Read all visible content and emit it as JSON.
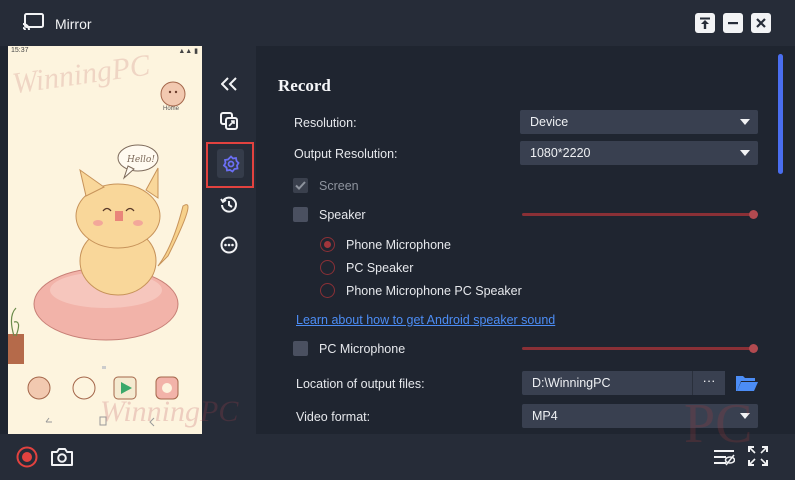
{
  "window": {
    "title": "Mirror"
  },
  "phone": {
    "status_time": "15:37",
    "status_signal": "▲▲ ▮",
    "home_app_label": "Home"
  },
  "record": {
    "section_title": "Record",
    "resolution_label": "Resolution:",
    "resolution_value": "Device",
    "output_resolution_label": "Output Resolution:",
    "output_resolution_value": "1080*2220",
    "screen_label": "Screen",
    "speaker_label": "Speaker",
    "speaker_volume": 1.0,
    "audio_options": [
      "Phone Microphone",
      "PC Speaker",
      "Phone Microphone  PC Speaker"
    ],
    "audio_selected": "Phone Microphone",
    "speaker_help_link": "Learn about how to get Android speaker sound",
    "pc_microphone_label": "PC Microphone",
    "pc_microphone_volume": 1.0,
    "output_location_label": "Location of output files:",
    "output_location_value": "D:\\WinningPC",
    "browse_label": "···",
    "video_format_label": "Video format:",
    "video_format_value": "MP4"
  },
  "watermark": {
    "text_top": "WinningPC",
    "text_bottom": "WinningPC",
    "text_corner": "PC"
  },
  "colors": {
    "accent": "#4a6ef0",
    "active_outline": "#e2423f",
    "record": "#e2423f",
    "slider": "#8a3036"
  }
}
